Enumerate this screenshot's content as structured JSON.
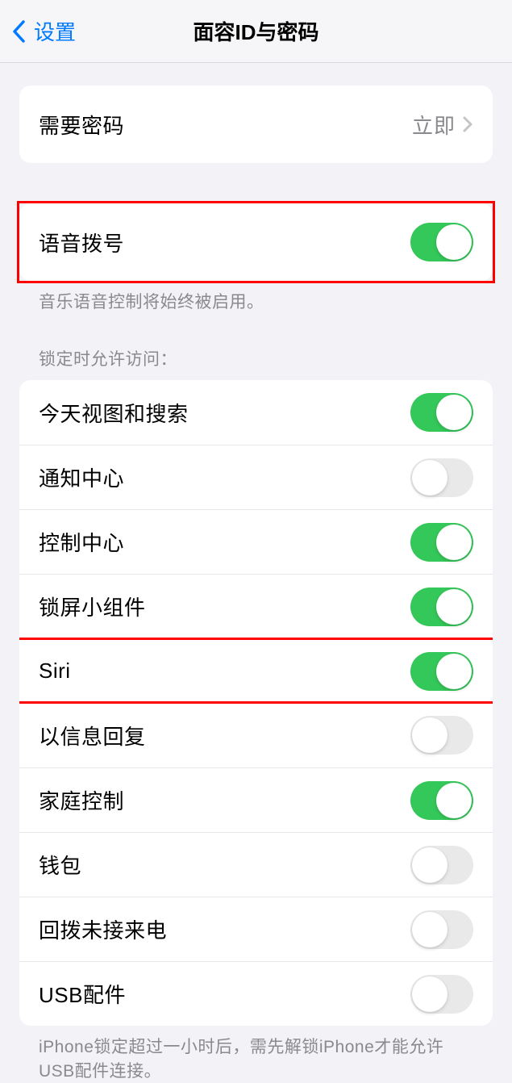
{
  "nav": {
    "back_label": "设置",
    "title": "面容ID与密码"
  },
  "passcode_group": {
    "require_passcode_label": "需要密码",
    "require_passcode_value": "立即"
  },
  "voice_dial": {
    "label": "语音拨号",
    "footer": "音乐语音控制将始终被启用。"
  },
  "lock_access": {
    "header": "锁定时允许访问：",
    "items": [
      {
        "label": "今天视图和搜索",
        "on": true
      },
      {
        "label": "通知中心",
        "on": false
      },
      {
        "label": "控制中心",
        "on": true
      },
      {
        "label": "锁屏小组件",
        "on": true
      },
      {
        "label": "Siri",
        "on": true
      },
      {
        "label": "以信息回复",
        "on": false
      },
      {
        "label": "家庭控制",
        "on": true
      },
      {
        "label": "钱包",
        "on": false
      },
      {
        "label": "回拨未接来电",
        "on": false
      },
      {
        "label": "USB配件",
        "on": false
      }
    ],
    "footer": "iPhone锁定超过一小时后，需先解锁iPhone才能允许USB配件连接。"
  }
}
